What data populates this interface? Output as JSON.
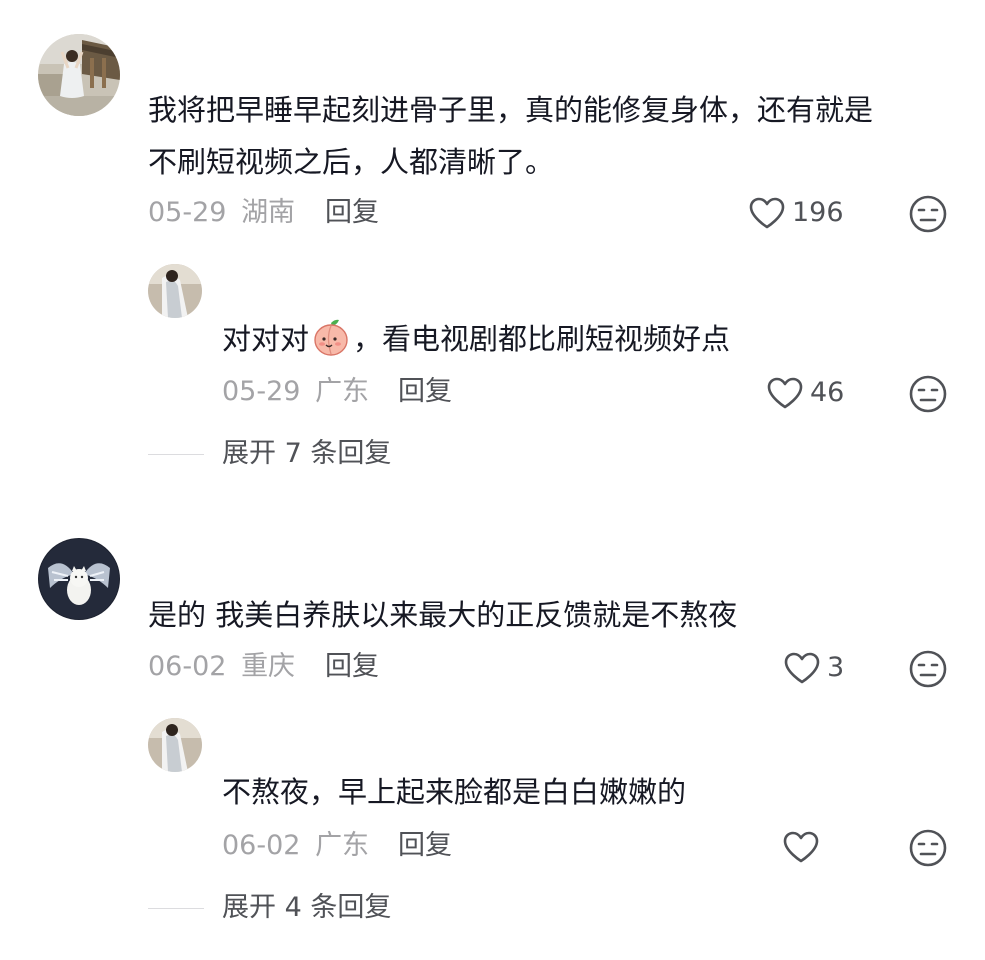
{
  "comments": [
    {
      "text_line1": "我将把早睡早起刻进骨子里，真的能修复身体，还有就是",
      "text_line2": "不刷短视频之后，人都清晰了。",
      "date": "05-29",
      "location": "湖南",
      "reply_label": "回复",
      "likes": "196",
      "reply": {
        "text_before_emoji": "对对对",
        "emoji": "peach-emoji",
        "text_after_emoji": "，看电视剧都比刷短视频好点",
        "date": "05-29",
        "location": "广东",
        "reply_label": "回复",
        "likes": "46"
      },
      "expand_label": "展开 7 条回复"
    },
    {
      "text_line1": "是的 我美白养肤以来最大的正反馈就是不熬夜",
      "date": "06-02",
      "location": "重庆",
      "reply_label": "回复",
      "likes": "3",
      "reply": {
        "text": "不熬夜，早上起来脸都是白白嫩嫩的",
        "date": "06-02",
        "location": "广东",
        "reply_label": "回复",
        "likes": ""
      },
      "expand_label": "展开 4 条回复"
    }
  ],
  "icons": {
    "like": "heart-outline-icon",
    "dislike": "meh-face-icon"
  },
  "colors": {
    "text": "#161823",
    "meta": "#a3a3a6",
    "action": "#505257",
    "icon": "#505257"
  }
}
